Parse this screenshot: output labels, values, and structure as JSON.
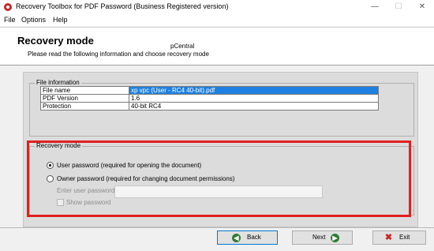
{
  "window": {
    "title": "Recovery Toolbox for PDF Password (Business Registered version)",
    "minimize": "—",
    "maximize": "☐",
    "close": "✕"
  },
  "menu": [
    "File",
    "Options",
    "Help"
  ],
  "header": {
    "title": "Recovery mode",
    "subtitle": "Please read the following information and choose recovery mode",
    "brand": "pCentral"
  },
  "file_info": {
    "label": "File information",
    "rows": [
      {
        "key": "File name",
        "value": "xp vpc (User - RC4 40-bit).pdf",
        "selected": true
      },
      {
        "key": "PDF Version",
        "value": "1.6"
      },
      {
        "key": "Protection",
        "value": "40-bit RC4"
      }
    ]
  },
  "recovery_mode": {
    "label": "Recovery mode",
    "options": [
      {
        "label": "User password (required for opening the document)",
        "checked": true
      },
      {
        "label": "Owner password (required for changing document permissions)",
        "checked": false
      }
    ],
    "password_label": "Enter user password",
    "password_value": "",
    "show_password_label": "Show password"
  },
  "buttons": {
    "back": "Back",
    "next": "Next",
    "exit": "Exit"
  },
  "colors": {
    "highlight": "#e02020",
    "selection": "#1e80e0"
  }
}
